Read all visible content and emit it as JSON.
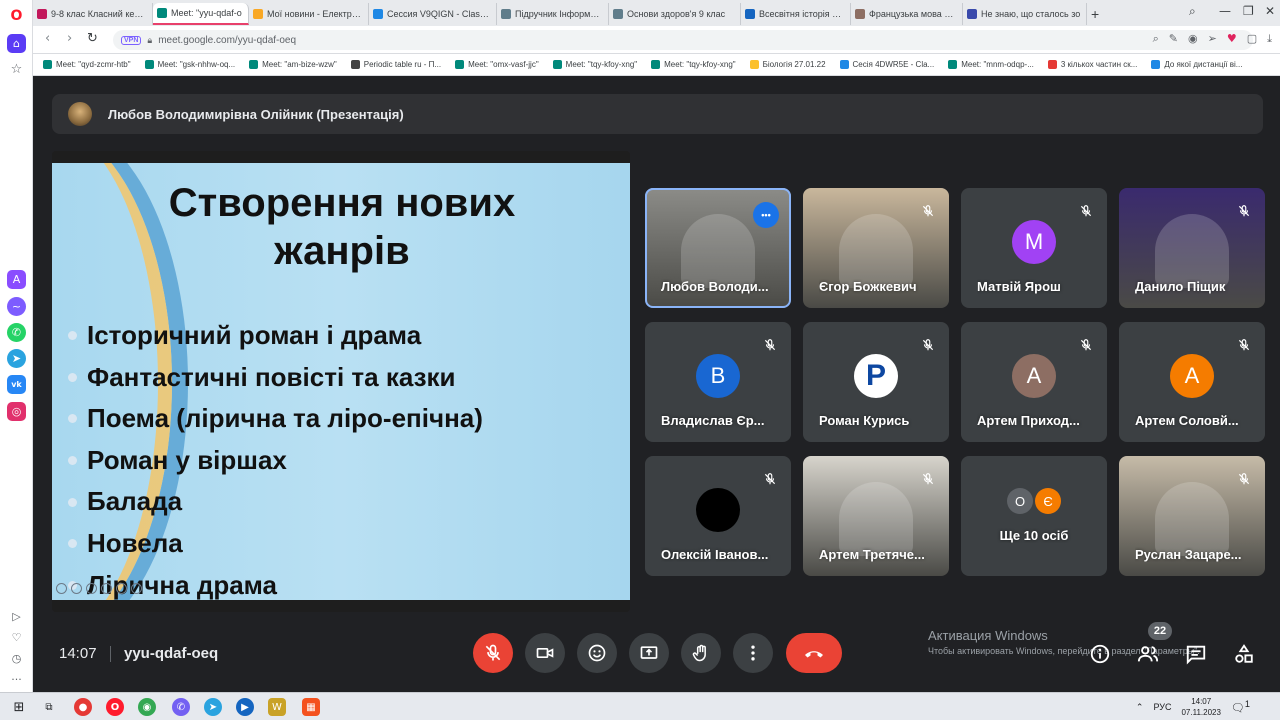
{
  "browser": {
    "tabs": [
      {
        "label": "9-8 клас Класний керівн",
        "color": "#c2185b"
      },
      {
        "label": "Meet: \"yyu-qdaf-o",
        "color": "#00897b",
        "active": true
      },
      {
        "label": "Мої новини - Електронн",
        "color": "#f9a825"
      },
      {
        "label": "Сессия V9QIGN - Classtim",
        "color": "#1e88e5"
      },
      {
        "label": "Підручник Інформатика",
        "color": "#607d8b"
      },
      {
        "label": "Основи здоров'я 9 клас",
        "color": "#607d8b"
      },
      {
        "label": "Всесвітня історія 9 клас І",
        "color": "#1565c0"
      },
      {
        "label": "Французька мова 9 клас",
        "color": "#8d6e63"
      },
      {
        "label": "Не знаю, що сталось зо",
        "color": "#3949ab"
      }
    ],
    "new_tab": "+",
    "url": "meet.google.com/yyu-qdaf-oeq",
    "vpn_label": "VPN",
    "bookmarks": [
      "Meet: \"qyd-zcmr-htb\"",
      "Meet: \"gsk-nhhw-oq...",
      "Meet: \"am-bize-wzw\"",
      "Periodic table ru - П...",
      "Meet: \"omx-vasf-jjc\"",
      "Meet: \"tqy-kfoy-xng\"",
      "Meet: \"tqy-kfoy-xng\"",
      "Біологія 27.01.22",
      "Сесія 4DWR5E - Cla...",
      "Meet: \"mnm-odqp-...",
      "3 кількох частин ск...",
      "До якої дистанції ві..."
    ]
  },
  "meet": {
    "presenter_bar_text": "Любов Володимирівна Олійник (Презентація)",
    "slide": {
      "title_line1": "Створення нових",
      "title_line2": "жанрів",
      "bullets": [
        "Історичний роман і драма",
        "Фантастичні повісті та казки",
        "Поема (лірична та ліро-епічна)",
        "Роман у віршах",
        "Балада",
        "Новела",
        "Лірична драма"
      ]
    },
    "participants": [
      {
        "name": "Любов Володи...",
        "bg": "#8c8c88"
      },
      {
        "name": "Єгор Божкевич",
        "bg": "#c9b79c"
      },
      {
        "name": "Матвій Ярош",
        "initial": "М",
        "avatar_color": "#a142f4"
      },
      {
        "name": "Данило Піщик",
        "bg": "#3a2a6e"
      },
      {
        "name": "Владислав Єр...",
        "initial": "В",
        "avatar_color": "#1967d2"
      },
      {
        "name": "Роман Курись",
        "initial": "P",
        "avatar_color": "#0d47a1"
      },
      {
        "name": "Артем Приход...",
        "initial": "А",
        "avatar_color": "#8d6e63"
      },
      {
        "name": "Артем Соловй...",
        "initial": "А",
        "avatar_color": "#f57c00"
      },
      {
        "name": "Олексій Іванов...",
        "avatar_color": "#000000"
      },
      {
        "name": "Артем Третяче...",
        "bg": "#d7d4cc"
      },
      {
        "name": "Ще 10 осіб",
        "mini": [
          "О",
          "Є"
        ]
      },
      {
        "name": "Руслан Зацаре...",
        "bg": "#c6bba8"
      }
    ],
    "more_others_initials": [
      "О",
      "Є"
    ],
    "more_others_colors": [
      "#5f6368",
      "#f57c00"
    ],
    "clock": "14:07",
    "meeting_code": "yyu-qdaf-oeq",
    "people_count": "22",
    "activation_line1": "Активация Windows",
    "activation_line2": "Чтобы активировать Windows, перейдите в раздел \"Параметры\"."
  },
  "taskbar": {
    "lang": "РУС",
    "time": "14:07",
    "date": "07.11.2023",
    "notifications": "1"
  }
}
